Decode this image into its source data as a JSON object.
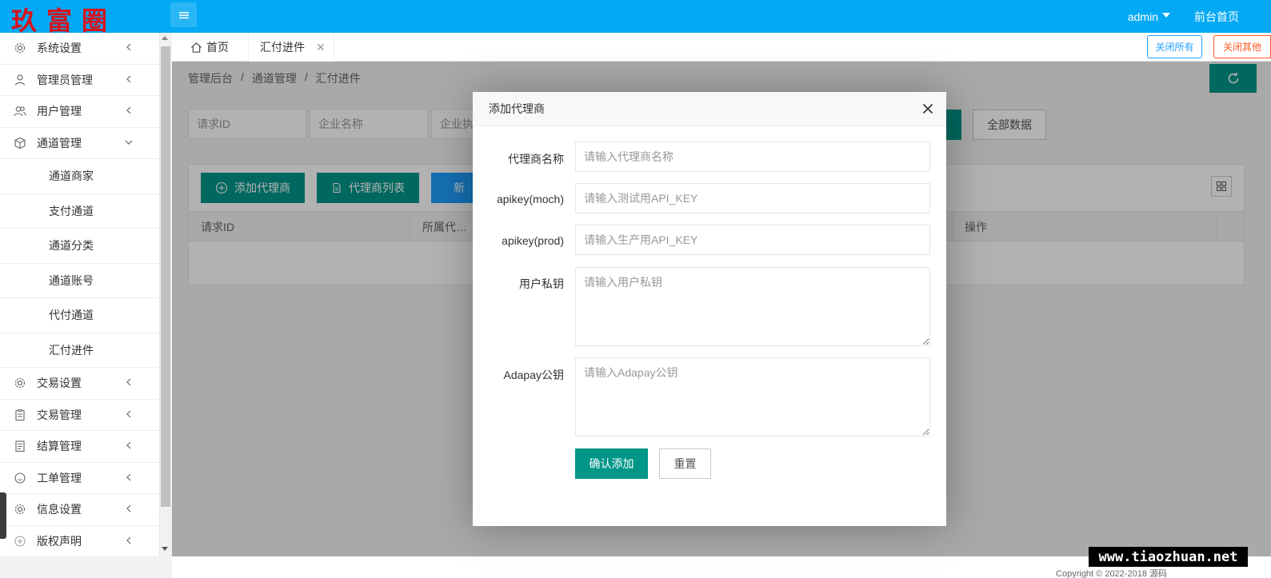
{
  "header": {
    "logo_text": "玖富圈",
    "user": "admin",
    "front_link": "前台首页"
  },
  "sidebar": {
    "items": [
      {
        "label": "系统设置",
        "icon": "gear-icon"
      },
      {
        "label": "管理员管理",
        "icon": "user-icon"
      },
      {
        "label": "用户管理",
        "icon": "users-icon"
      },
      {
        "label": "通道管理",
        "icon": "cube-icon",
        "expanded": true
      },
      {
        "label": "交易设置",
        "icon": "gear-icon"
      },
      {
        "label": "交易管理",
        "icon": "clipboard-icon"
      },
      {
        "label": "结算管理",
        "icon": "document-icon"
      },
      {
        "label": "工单管理",
        "icon": "smile-icon"
      },
      {
        "label": "信息设置",
        "icon": "gear-icon"
      },
      {
        "label": "版权声明",
        "icon": "plus-circle-icon"
      }
    ],
    "subitems": [
      "通道商家",
      "支付通道",
      "通道分类",
      "通道账号",
      "代付通道",
      "汇付进件"
    ]
  },
  "tabs": {
    "home": "首页",
    "active": "汇付进件",
    "close_all": "关闭所有",
    "close_other": "关闭其他"
  },
  "breadcrumb": [
    "管理后台",
    "/",
    "通道管理",
    "/",
    "汇付进件"
  ],
  "search": {
    "placeholders": [
      "请求ID",
      "企业名称",
      "企业执"
    ],
    "all_data": "全部数据"
  },
  "toolbar": {
    "add_agent": "添加代理商",
    "agent_list": "代理商列表",
    "new": "新"
  },
  "table": {
    "columns": [
      "请求ID",
      "所属代…",
      "操作"
    ]
  },
  "modal": {
    "title": "添加代理商",
    "fields": [
      {
        "label": "代理商名称",
        "placeholder": "请输入代理商名称"
      },
      {
        "label": "apikey(moch)",
        "placeholder": "请输入测试用API_KEY"
      },
      {
        "label": "apikey(prod)",
        "placeholder": "请输入生产用API_KEY"
      },
      {
        "label": "用户私钥",
        "placeholder": "请输入用户私钥"
      },
      {
        "label": "Adapay公钥",
        "placeholder": "请输入Adapay公钥"
      }
    ],
    "confirm": "确认添加",
    "reset": "重置"
  },
  "footer": {
    "copyright": "Copyright © 2022-2018 源码"
  },
  "watermark": "www.tiaozhuan.net",
  "colors": {
    "header_bg": "#03a9f4",
    "primary": "#009688",
    "blue": "#1e9fff",
    "danger": "#ff5722"
  }
}
